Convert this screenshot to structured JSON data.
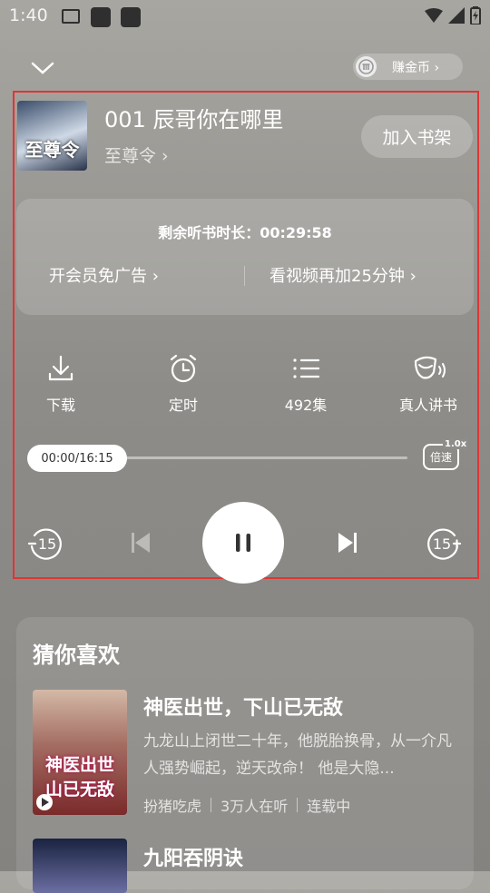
{
  "status_bar": {
    "time": "1:40"
  },
  "header": {
    "earn_coins": "赚金币 ›"
  },
  "player": {
    "episode_title": "001 辰哥你在哪里",
    "author": "至尊令 ›",
    "cover_text": "至尊令",
    "add_shelf": "加入书架",
    "remaining_label": "剩余听书时长：00:29:58",
    "vip_promo": "开会员免广告 ›",
    "video_promo": "看视频再加25分钟 ›",
    "functions": [
      {
        "label": "下载",
        "icon": "download-icon"
      },
      {
        "label": "定时",
        "icon": "alarm-clock-icon"
      },
      {
        "label": "492集",
        "icon": "playlist-icon"
      },
      {
        "label": "真人讲书",
        "icon": "headphone-speaker-icon"
      }
    ],
    "progress_time": "00:00/16:15",
    "progress_fraction": 0.0,
    "speed_label": "倍速",
    "speed_value": "1.0x",
    "rewind_seconds": "15",
    "forward_seconds": "15",
    "state": "playing"
  },
  "recommend": {
    "heading": "猜你喜欢",
    "books": [
      {
        "title": "神医出世，下山已无敌",
        "cover_text": "神医出世 山已无敌",
        "desc": "九龙山上闭世二十年，他脱胎换骨，从一介凡人强势崛起，逆天改命！ 他是大隐...",
        "author": "扮猪吃虎",
        "listeners": "3万人在听",
        "status": "连载中"
      },
      {
        "title": "九阳吞阴诀"
      }
    ]
  }
}
